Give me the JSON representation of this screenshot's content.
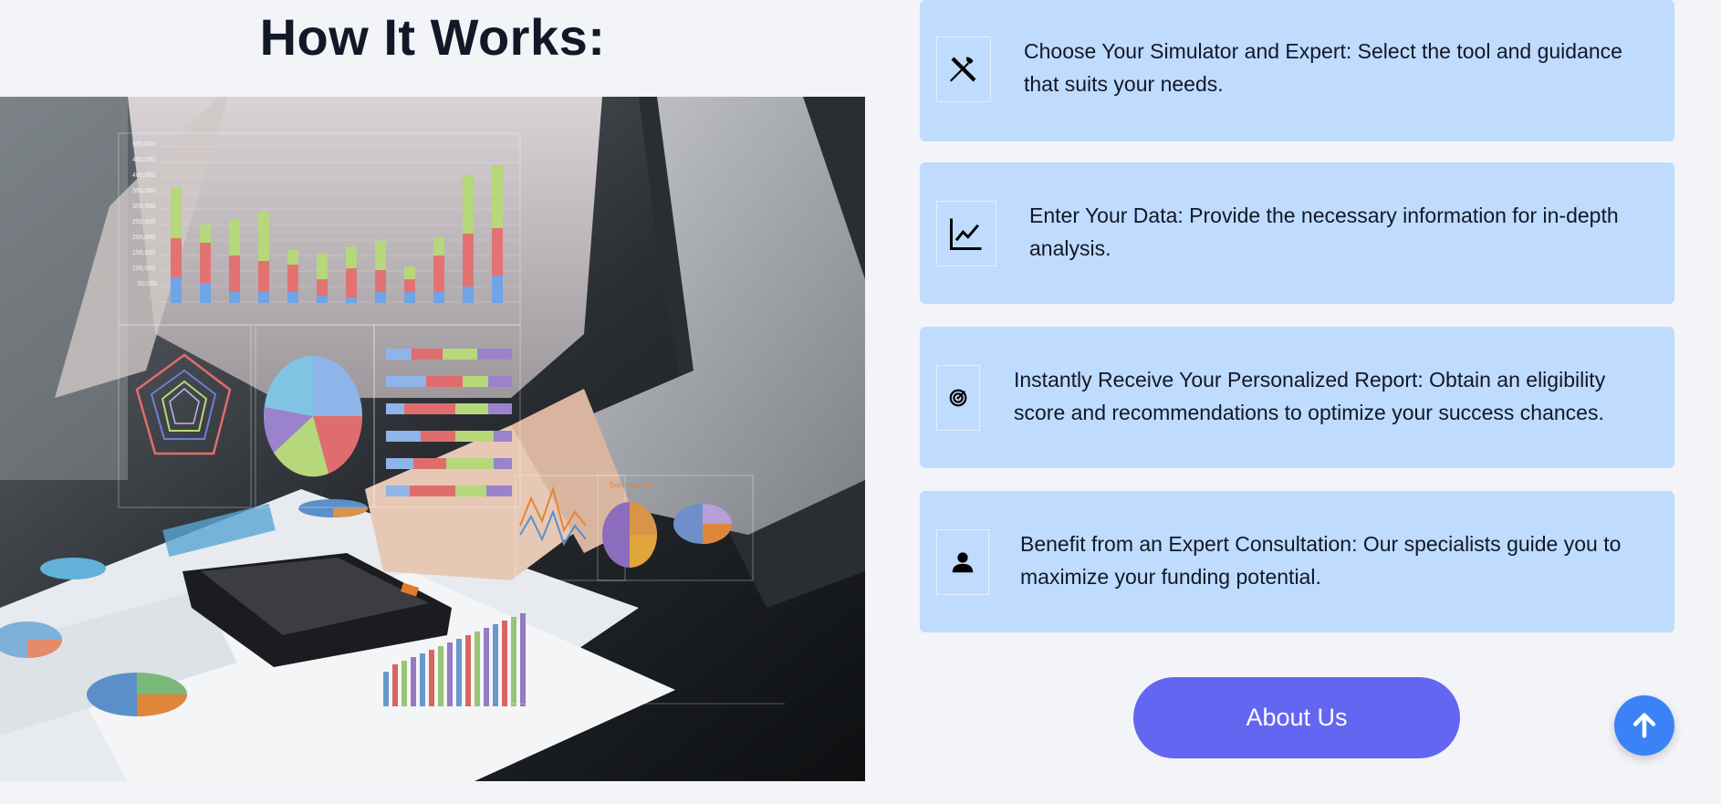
{
  "section": {
    "title": "How It Works:"
  },
  "photo": {
    "description_icon": "business-analytics-photo",
    "overlay_text": {
      "summary_label": "Summary tab",
      "y_ticks": [
        "500,000",
        "450,000",
        "400,000",
        "350,000",
        "300,000",
        "250,000",
        "200,000",
        "150,000",
        "100,000",
        "50,000",
        "-"
      ]
    }
  },
  "steps": [
    {
      "icon": "tools-icon",
      "text": "Choose Your Simulator and Expert: Select the tool and guidance that suits your needs."
    },
    {
      "icon": "line-chart-icon",
      "text": "Enter Your Data: Provide the necessary information for in-depth analysis."
    },
    {
      "icon": "target-icon",
      "text": "Instantly Receive Your Personalized Report: Obtain an eligibility score and recommendations to optimize your success chances."
    },
    {
      "icon": "person-icon",
      "text": "Benefit from an Expert Consultation: Our specialists guide you to maximize your funding potential."
    }
  ],
  "actions": {
    "about_label": "About Us",
    "scroll_top_icon": "arrow-up-icon"
  },
  "colors": {
    "card_bg": "#bfdbfe",
    "button_bg": "#6366f1",
    "scroll_btn_bg": "#3b82f6",
    "page_bg": "#f2f4f7"
  }
}
